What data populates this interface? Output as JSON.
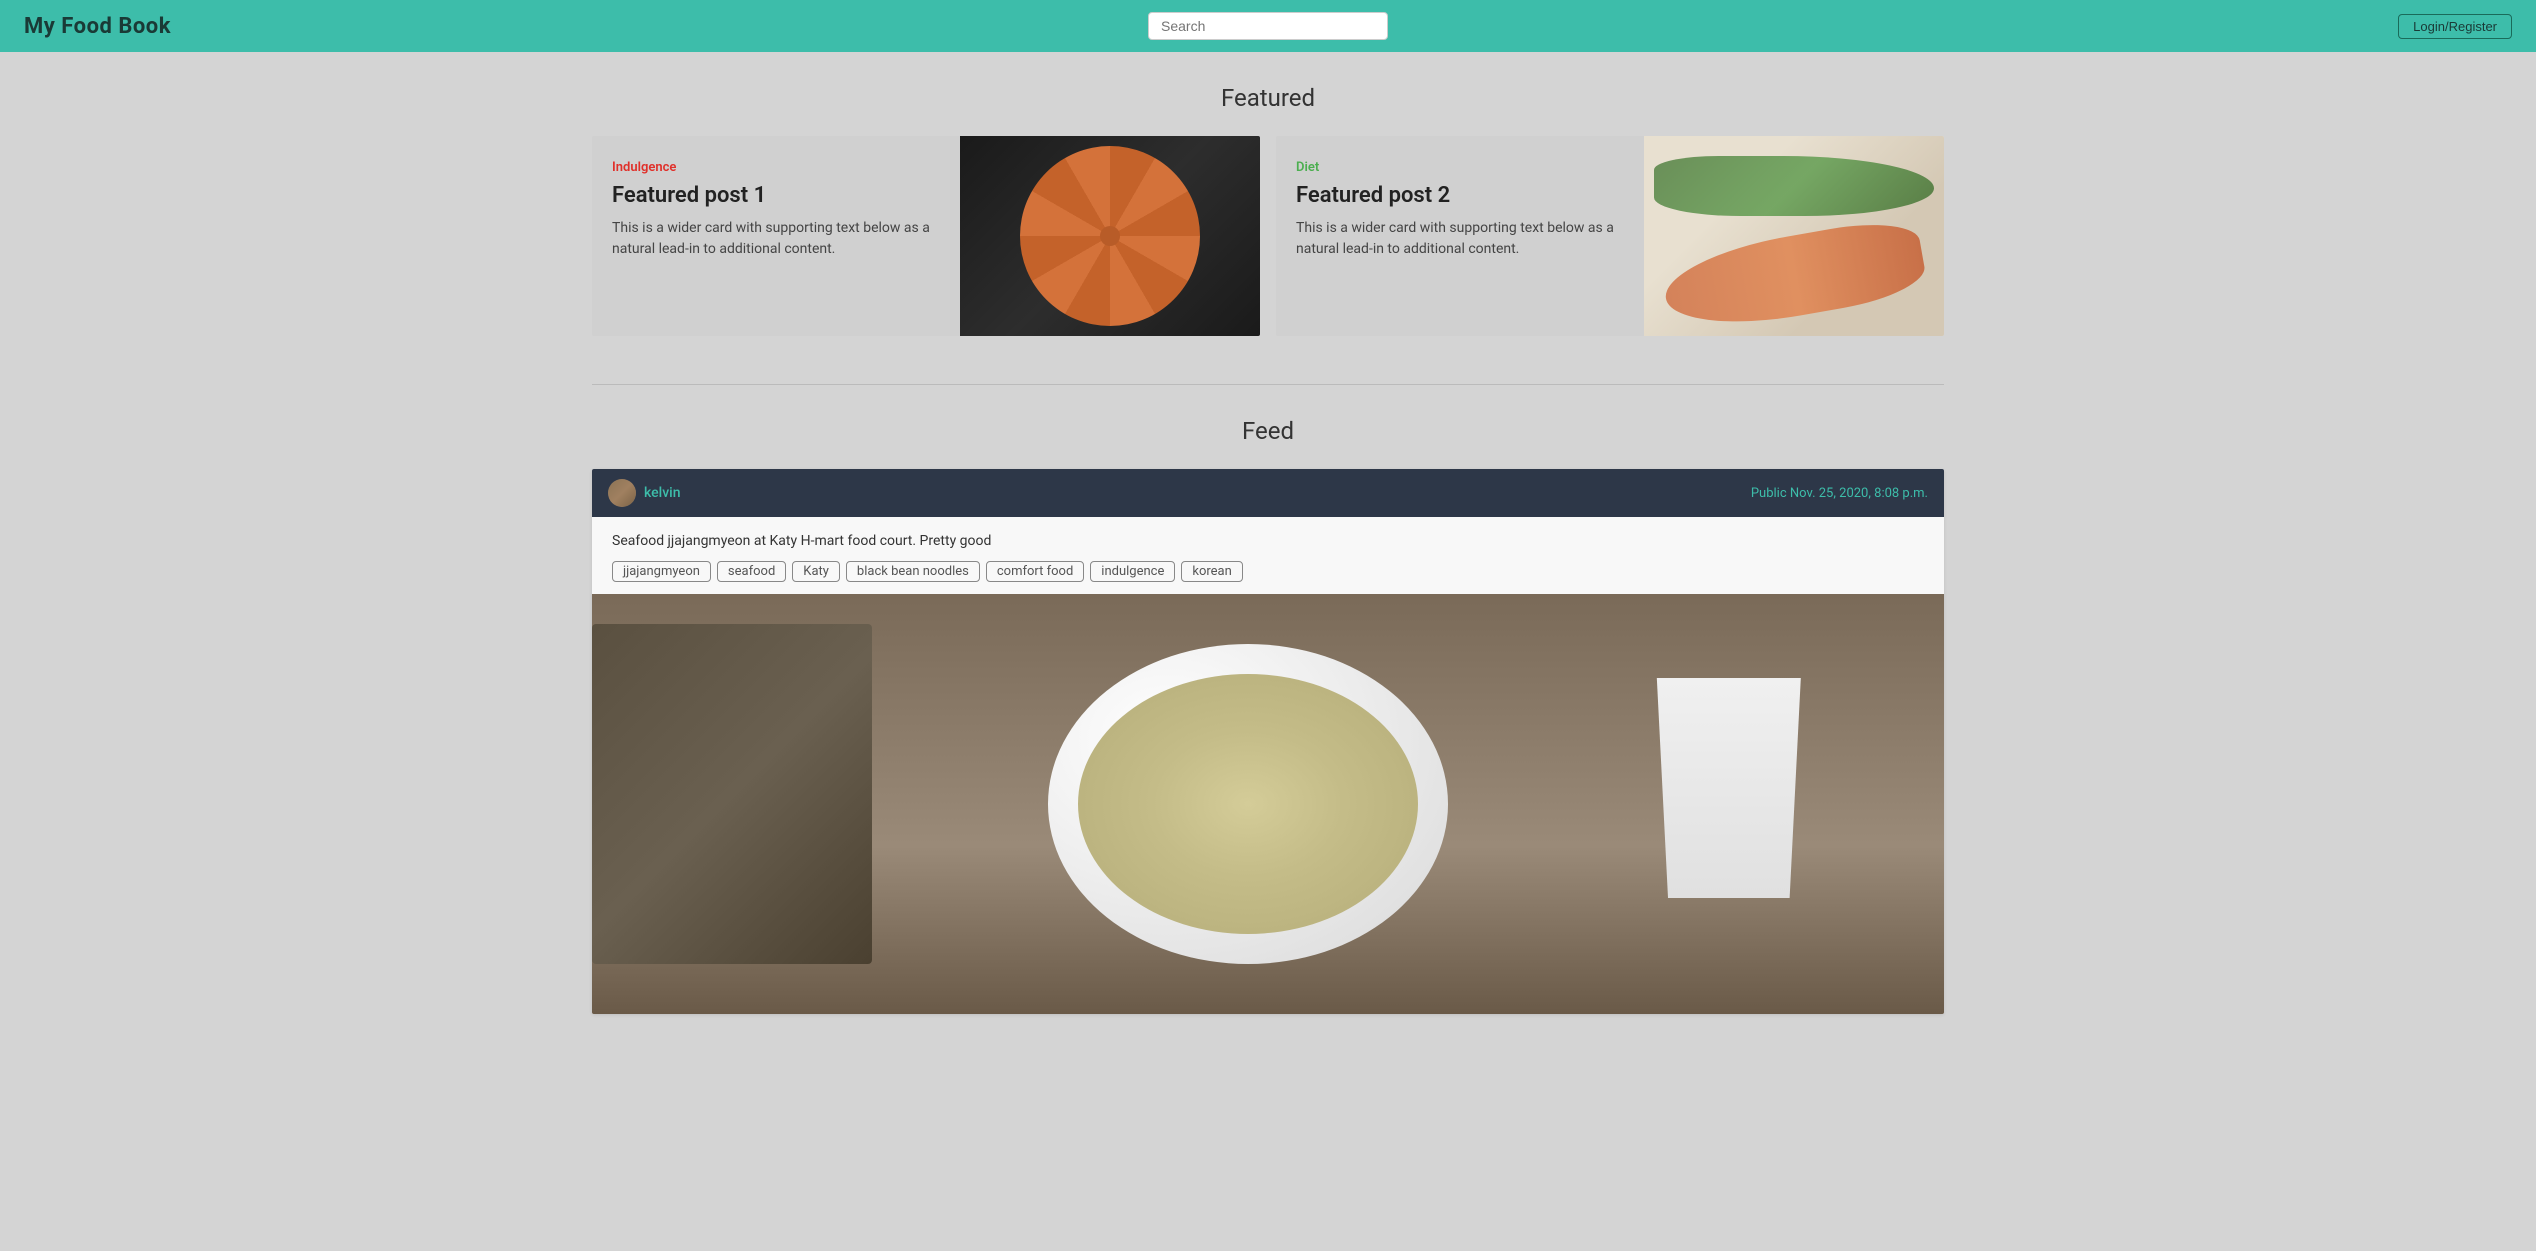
{
  "navbar": {
    "brand": "My Food Book",
    "search_placeholder": "Search",
    "login_label": "Login/Register"
  },
  "featured_section": {
    "title": "Featured",
    "cards": [
      {
        "category": "Indulgence",
        "category_class": "indulgence",
        "title": "Featured post 1",
        "description": "This is a wider card with supporting text below as a natural lead-in to additional content.",
        "image_alt": "Pizza image"
      },
      {
        "category": "Diet",
        "category_class": "diet",
        "title": "Featured post 2",
        "description": "This is a wider card with supporting text below as a natural lead-in to additional content.",
        "image_alt": "Salmon dish image"
      }
    ]
  },
  "feed_section": {
    "title": "Feed",
    "posts": [
      {
        "username": "kelvin",
        "visibility": "Public",
        "timestamp": "Nov. 25, 2020, 8:08 p.m.",
        "caption": "Seafood jjajangmyeon at Katy H-mart food court. Pretty good",
        "tags": [
          "jjajangmyeon",
          "seafood",
          "Katy",
          "black bean noodles",
          "comfort food",
          "indulgence",
          "korean"
        ]
      }
    ]
  }
}
